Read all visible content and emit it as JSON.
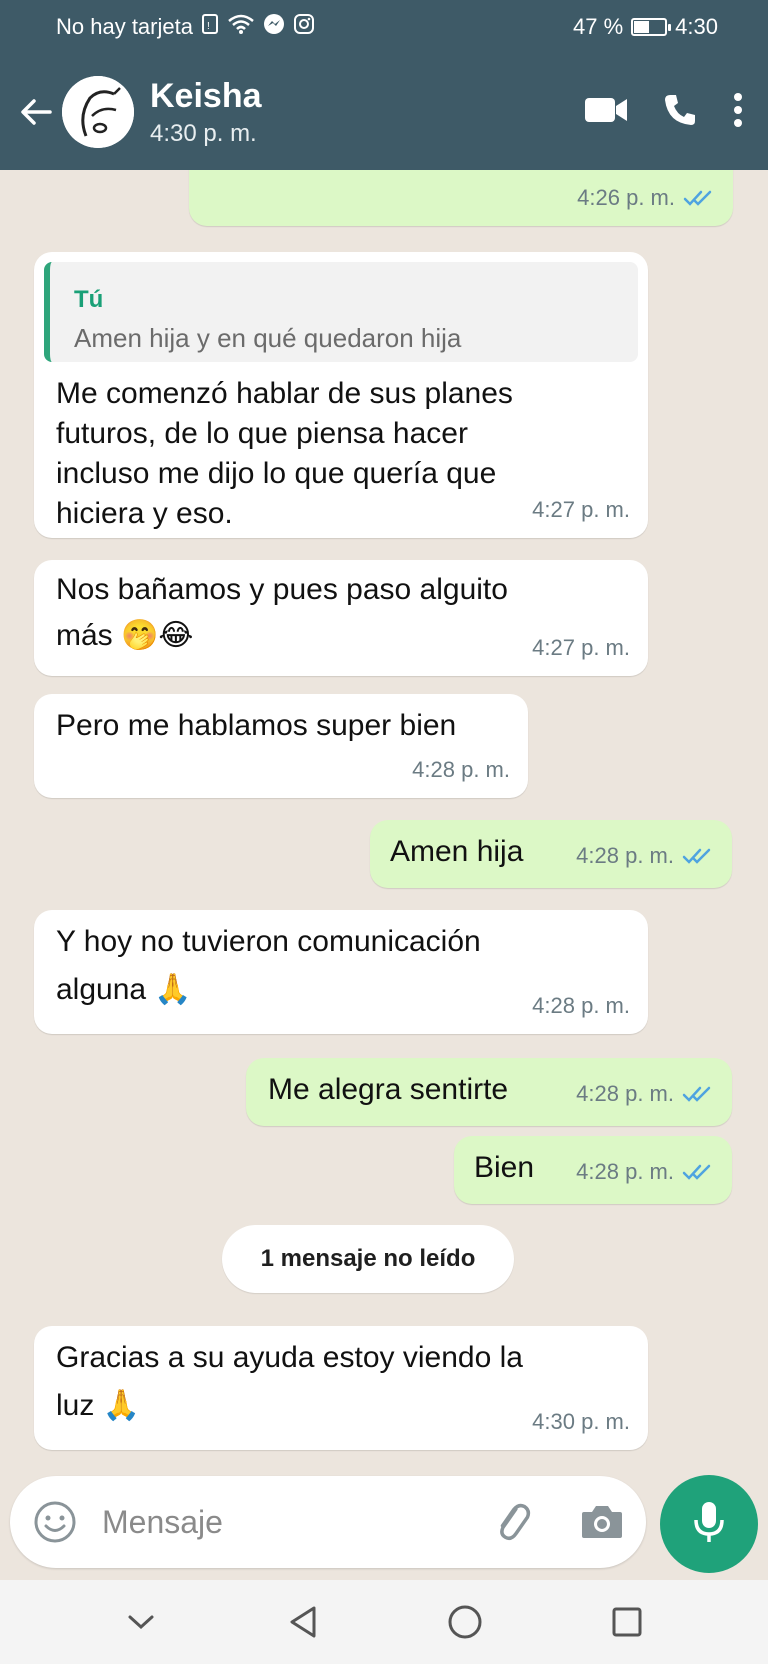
{
  "status_bar": {
    "carrier": "No hay tarjeta",
    "battery": "47 %",
    "battery_level": 0.47,
    "time": "4:30"
  },
  "header": {
    "contact_name": "Keisha",
    "last_seen": "4:30 p. m.",
    "icons": [
      "back-arrow-icon",
      "video-call-icon",
      "phone-icon",
      "more-vert-icon"
    ]
  },
  "messages": [
    {
      "direction": "out",
      "text": "",
      "time": "4:26 p. m.",
      "status": "read"
    },
    {
      "direction": "in",
      "quote": {
        "author": "Tú",
        "text": "Amen hija y en qué quedaron hija"
      },
      "lines": [
        "Me comenzó hablar de sus planes",
        "futuros, de lo que piensa hacer",
        "incluso me dijo lo que quería que",
        "hiciera y eso."
      ],
      "time": "4:27 p. m."
    },
    {
      "direction": "in",
      "lines": [
        "Nos bañamos y pues paso alguito",
        "más 🤭😂"
      ],
      "time": "4:27 p. m."
    },
    {
      "direction": "in",
      "lines": [
        "Pero me hablamos super bien"
      ],
      "time": "4:28 p. m."
    },
    {
      "direction": "out",
      "text": "Amen hija",
      "time": "4:28 p. m.",
      "status": "read"
    },
    {
      "direction": "in",
      "lines": [
        "Y hoy no tuvieron comunicación",
        "alguna 🙏"
      ],
      "time": "4:28 p. m."
    },
    {
      "direction": "out",
      "text": "Me alegra sentirte",
      "time": "4:28 p. m.",
      "status": "read"
    },
    {
      "direction": "out",
      "text": "Bien",
      "time": "4:28 p. m.",
      "status": "read"
    },
    {
      "direction": "in",
      "lines": [
        "Gracias a su ayuda estoy viendo la",
        "luz 🙏"
      ],
      "time": "4:30 p. m."
    }
  ],
  "unread_divider": "1 mensaje no leído",
  "composer": {
    "placeholder": "Mensaje",
    "icons": [
      "emoji-icon",
      "attach-icon",
      "camera-icon",
      "mic-icon"
    ]
  },
  "colors": {
    "header_bg": "#3e5a67",
    "incoming_bubble": "#ffffff",
    "outgoing_bubble": "#dcf8c6",
    "chat_bg": "#ece5dd",
    "accent_green": "#1fa27a",
    "read_ticks": "#4fa3e0"
  }
}
